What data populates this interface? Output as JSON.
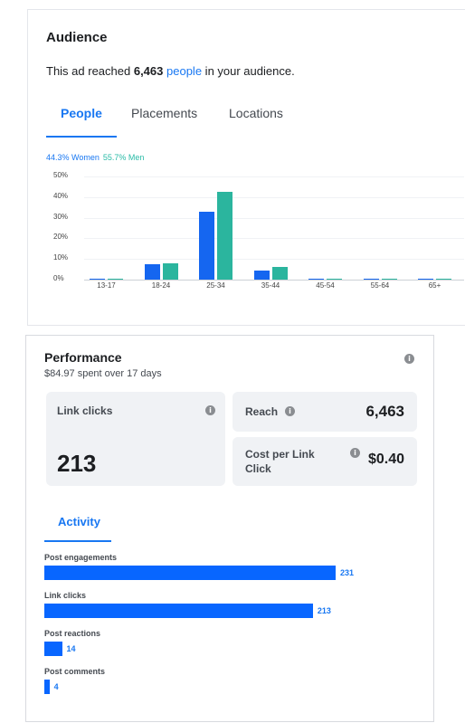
{
  "audience": {
    "title": "Audience",
    "reach_prefix": "This ad reached ",
    "reach_count": "6,463",
    "reach_link": "people",
    "reach_suffix": " in your audience.",
    "tabs": [
      "People",
      "Placements",
      "Locations"
    ],
    "active_tab": "People",
    "legend_women": "44.3% Women",
    "legend_men": "55.7% Men"
  },
  "chart_data": {
    "type": "bar",
    "categories": [
      "13-17",
      "18-24",
      "25-34",
      "35-44",
      "45-54",
      "55-64",
      "65+"
    ],
    "series": [
      {
        "name": "44.3% Women",
        "color": "#1566f0",
        "values": [
          0.3,
          7.5,
          33,
          4.5,
          0.5,
          0.3,
          0.3
        ]
      },
      {
        "name": "55.7% Men",
        "color": "#2bb59e",
        "values": [
          0.3,
          8,
          42.5,
          6,
          0.5,
          0.3,
          0.3
        ]
      }
    ],
    "y_ticks": [
      "50%",
      "40%",
      "30%",
      "20%",
      "10%",
      "0%"
    ],
    "ylim": [
      0,
      50
    ],
    "title": "",
    "xlabel": "",
    "ylabel": ""
  },
  "performance": {
    "title": "Performance",
    "spent_line": "$84.97 spent over 17 days",
    "link_clicks_label": "Link clicks",
    "link_clicks_value": "213",
    "reach_label": "Reach",
    "reach_value": "6,463",
    "cpc_label_line1": "Cost per Link",
    "cpc_label_line2": "Click",
    "cpc_value": "$0.40",
    "info_glyph": "i",
    "activity_tab": "Activity",
    "activity": [
      {
        "label": "Post engagements",
        "value": 231,
        "value_text": "231"
      },
      {
        "label": "Link clicks",
        "value": 213,
        "value_text": "213"
      },
      {
        "label": "Post reactions",
        "value": 14,
        "value_text": "14"
      },
      {
        "label": "Post comments",
        "value": 4,
        "value_text": "4"
      }
    ]
  }
}
